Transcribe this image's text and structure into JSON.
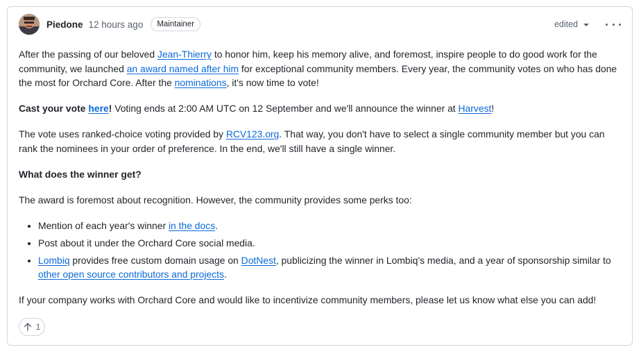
{
  "comment": {
    "author": "Piedone",
    "time": "12 hours ago",
    "badge": "Maintainer",
    "edited": "edited",
    "icons": {
      "avatar": "avatar",
      "caret": "chevron-down-icon",
      "menu": "kebab-horizontal-icon",
      "upvote": "arrow-up-icon"
    },
    "p1": {
      "t1": "After the passing of our beloved ",
      "l1": "Jean-Thierry",
      "t2": " to honor him, keep his memory alive, and foremost, inspire people to do good work for the community, we launched ",
      "l2": "an award named after him",
      "t3": " for exceptional community members. Every year, the community votes on who has done the most for Orchard Core. After the ",
      "l3": "nominations",
      "t4": ", it's now time to vote!"
    },
    "p2": {
      "b1": "Cast your vote ",
      "l1": "here",
      "b2": "!",
      "t1": " Voting ends at 2:00 AM UTC on 12 September and we'll announce the winner at ",
      "l2": "Harvest",
      "t2": "!"
    },
    "p3": {
      "t1": "The vote uses ranked-choice voting provided by ",
      "l1": "RCV123.org",
      "t2": ". That way, you don't have to select a single community member but you can rank the nominees in your order of preference. In the end, we'll still have a single winner."
    },
    "p4": "What does the winner get?",
    "p5": "The award is foremost about recognition. However, the community provides some perks too:",
    "li1": {
      "t1": "Mention of each year's winner ",
      "l1": "in the docs",
      "t2": "."
    },
    "li2": "Post about it under the Orchard Core social media.",
    "li3": {
      "l1": "Lombiq",
      "t1": " provides free custom domain usage on ",
      "l2": "DotNest",
      "t2": ", publicizing the winner in Lombiq's media, and a year of sponsorship similar to ",
      "l3": "other open source contributors and projects",
      "t3": "."
    },
    "p6": "If your company works with Orchard Core and would like to incentivize community members, please let us know what else you can add!",
    "reaction_count": "1"
  }
}
